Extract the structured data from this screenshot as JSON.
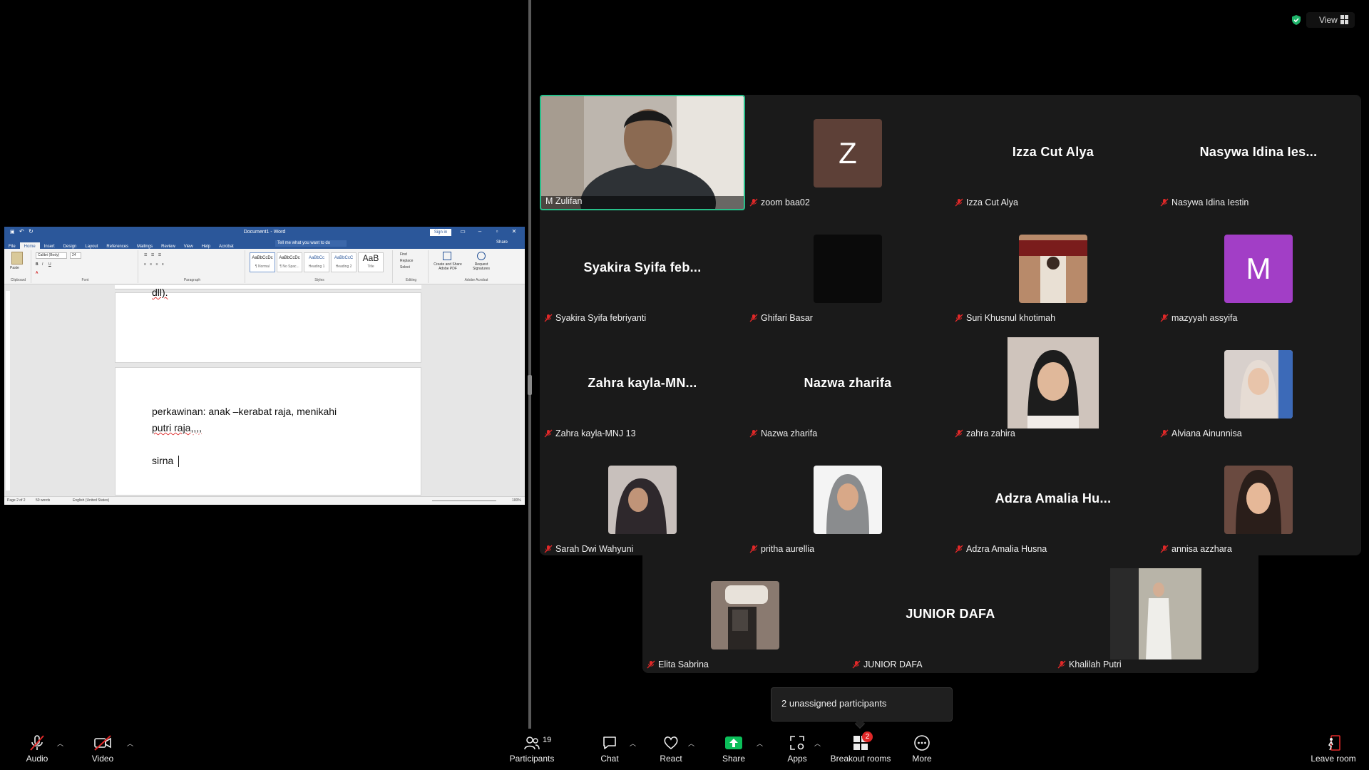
{
  "word": {
    "title": "Document1 - Word",
    "signin": "Sign in",
    "tabs": [
      "File",
      "Home",
      "Insert",
      "Design",
      "Layout",
      "References",
      "Mailings",
      "Review",
      "View",
      "Help",
      "Acrobat"
    ],
    "tell_me": "Tell me what you want to do",
    "share": "Share",
    "font_name": "Calibri (Body)",
    "font_size": "24",
    "styles": [
      {
        "preview": "AaBbCcDc",
        "name": "¶ Normal"
      },
      {
        "preview": "AaBbCcDc",
        "name": "¶ No Spac..."
      },
      {
        "preview": "AaBbCc",
        "name": "Heading 1"
      },
      {
        "preview": "AaBbCcC",
        "name": "Heading 2"
      },
      {
        "preview": "AaB",
        "name": "Title"
      }
    ],
    "editing": [
      "Find",
      "Replace",
      "Select"
    ],
    "acrobat_labels": [
      "Create and Share Adobe PDF",
      "Request Signatures"
    ],
    "groups": [
      "Clipboard",
      "Font",
      "Paragraph",
      "Styles",
      "Editing",
      "Adobe Acrobat"
    ],
    "paste_label": "Paste",
    "page1_tail": "dll).",
    "page2_line1": "perkawinan: anak –kerabat raja, menikahi",
    "page2_line2": "putri raja,,,,",
    "page2_line3": "sirna",
    "status": {
      "page": "Page 2 of 2",
      "words": "50 words",
      "language": "English (United States)",
      "zoom": "100%"
    }
  },
  "view_button": "View",
  "participants": [
    {
      "name": "M Zulifan",
      "type": "video",
      "display": ""
    },
    {
      "name": "zoom baa02",
      "type": "letter",
      "display": "Z",
      "color": "#5d4037"
    },
    {
      "name": "Izza Cut Alya",
      "type": "name",
      "display": "Izza Cut Alya"
    },
    {
      "name": "Nasywa Idina Iestin",
      "type": "name",
      "display": "Nasywa  Idina  Ies..."
    },
    {
      "name": "Syakira Syifa febriyanti",
      "type": "name",
      "display": "Syakira  Syifa  feb..."
    },
    {
      "name": "Ghifari Basar",
      "type": "photo",
      "display": "",
      "color": "#0a0a0a"
    },
    {
      "name": "Suri Khusnul khotimah",
      "type": "photo",
      "display": "",
      "color": "#8a4a3a"
    },
    {
      "name": "mazyyah assyifa",
      "type": "letter",
      "display": "M",
      "color": "#a23ec6"
    },
    {
      "name": "Zahra kayla-MNJ 13",
      "type": "name",
      "display": "Zahra  kayla-MN..."
    },
    {
      "name": "Nazwa zharifa",
      "type": "name",
      "display": "Nazwa zharifa"
    },
    {
      "name": "zahra zahira",
      "type": "photo-large",
      "display": "",
      "color": "#cfc4bc"
    },
    {
      "name": "Alviana Ainunnisa",
      "type": "photo",
      "display": "",
      "color": "#d8d0cc"
    },
    {
      "name": "Sarah Dwi Wahyuni",
      "type": "photo",
      "display": "",
      "color": "#3a3236"
    },
    {
      "name": "pritha aurellia",
      "type": "photo",
      "display": "",
      "color": "#f4f4f4"
    },
    {
      "name": "Adzra Amalia Husna",
      "type": "name",
      "display": "Adzra  Amalia  Hu..."
    },
    {
      "name": "annisa azzhara",
      "type": "photo",
      "display": "",
      "color": "#5a3a30"
    },
    {
      "name": "Elita Sabrina",
      "type": "photo",
      "display": "",
      "color": "#6a5a52"
    },
    {
      "name": "JUNIOR DAFA",
      "type": "name",
      "display": "JUNIOR DAFA"
    },
    {
      "name": "Khalilah Putri",
      "type": "photo-large",
      "display": "",
      "color": "#b8b4a8"
    }
  ],
  "unassigned": "2 unassigned participants",
  "toolbar": {
    "audio": "Audio",
    "video": "Video",
    "participants": "Participants",
    "participants_count": "19",
    "chat": "Chat",
    "react": "React",
    "share": "Share",
    "apps": "Apps",
    "breakout": "Breakout rooms",
    "breakout_badge": "2",
    "more": "More",
    "leave": "Leave room"
  },
  "colors": {
    "active_border": "#27c08a",
    "share_green": "#0bbf5a",
    "mute_red": "#e02828",
    "word_blue": "#2b579a"
  }
}
